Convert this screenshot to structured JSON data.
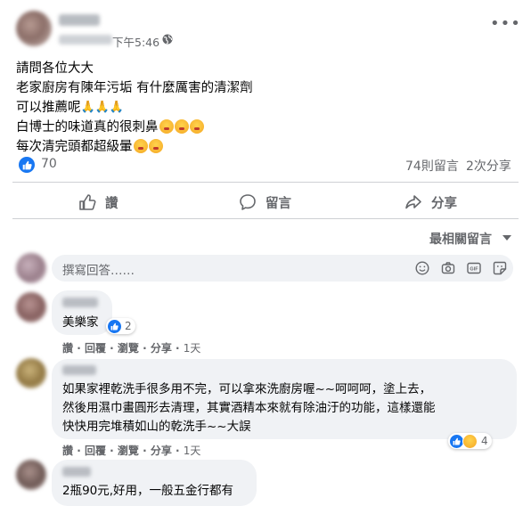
{
  "post": {
    "time": "下午5:46",
    "lines": [
      "請問各位大大",
      "老家廚房有陳年污垢 有什麼厲害的清潔劑",
      "可以推薦呢",
      "白博士的味道真的很刺鼻",
      "每次清完頭都超級暈"
    ],
    "line3_emoji": "🙏🙏🙏",
    "reactions_count": "70",
    "comments_count": "74則留言",
    "shares_count": "2次分享"
  },
  "actions": {
    "like": "讚",
    "comment": "留言",
    "share": "分享"
  },
  "sort_label": "最相關留言",
  "reply_input": {
    "placeholder": "撰寫回答……"
  },
  "comments": [
    {
      "lines": [
        "美樂家"
      ],
      "reaction_count": "2",
      "meta": [
        "讚",
        "回覆",
        "分享",
        "1天"
      ]
    },
    {
      "lines": [
        "如果家裡乾洗手很多用不完，可以拿來洗廚房喔~~呵呵呵，塗上去，",
        "然後用濕巾畫圓形去清理，其實酒精本來就有除油汙的功能，這樣還能",
        "快快用完堆積如山的乾洗手~~大誤"
      ],
      "reaction_count": "4",
      "meta": [
        "讚",
        "回覆",
        "分享",
        "1天"
      ]
    },
    {
      "lines": [
        "2瓶90元,好用，一般五金行都有"
      ]
    }
  ],
  "colors": {
    "accent": "#1877f2",
    "secondary_text": "#65676b",
    "bubble": "#f0f2f5",
    "divider": "#ced0d4"
  },
  "icons": [
    "globe-icon",
    "more-icon",
    "like-icon",
    "comment-icon",
    "share-icon",
    "emoji-icon",
    "camera-icon",
    "gif-icon",
    "sticker-icon"
  ]
}
